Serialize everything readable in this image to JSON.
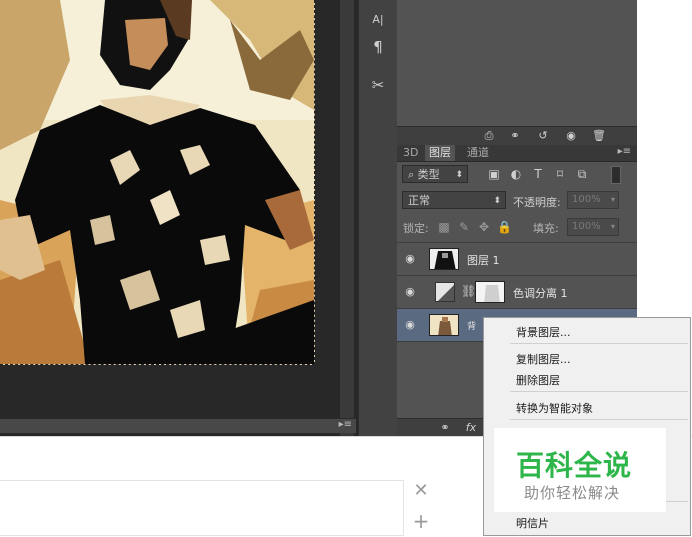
{
  "tools": [
    {
      "name": "character-icon",
      "glyph": "A|"
    },
    {
      "name": "paragraph-icon",
      "glyph": "¶"
    },
    {
      "name": "tools-icon",
      "glyph": "✂"
    }
  ],
  "layers_panel": {
    "tabs": [
      "3D",
      "图层",
      "通道"
    ],
    "filter_kind": "类型",
    "blend_mode": "正常",
    "opacity_label": "不透明度:",
    "opacity_value": "100%",
    "lock_label": "锁定:",
    "fill_label": "填充:",
    "fill_value": "100%",
    "layers": [
      {
        "name": "图层 1"
      },
      {
        "name": "色调分离 1"
      },
      {
        "name": "背"
      }
    ]
  },
  "context_menu": {
    "items": [
      "背景图层...",
      "复制图层...",
      "删除图层",
      "转换为智能对象",
      "明信片"
    ]
  },
  "watermark": {
    "title": "百科全说",
    "subtitle": "助你轻松解决"
  },
  "colors": {
    "panel_bg": "#535353",
    "panel_dark": "#383838",
    "watermark_green": "#2fb64a"
  }
}
